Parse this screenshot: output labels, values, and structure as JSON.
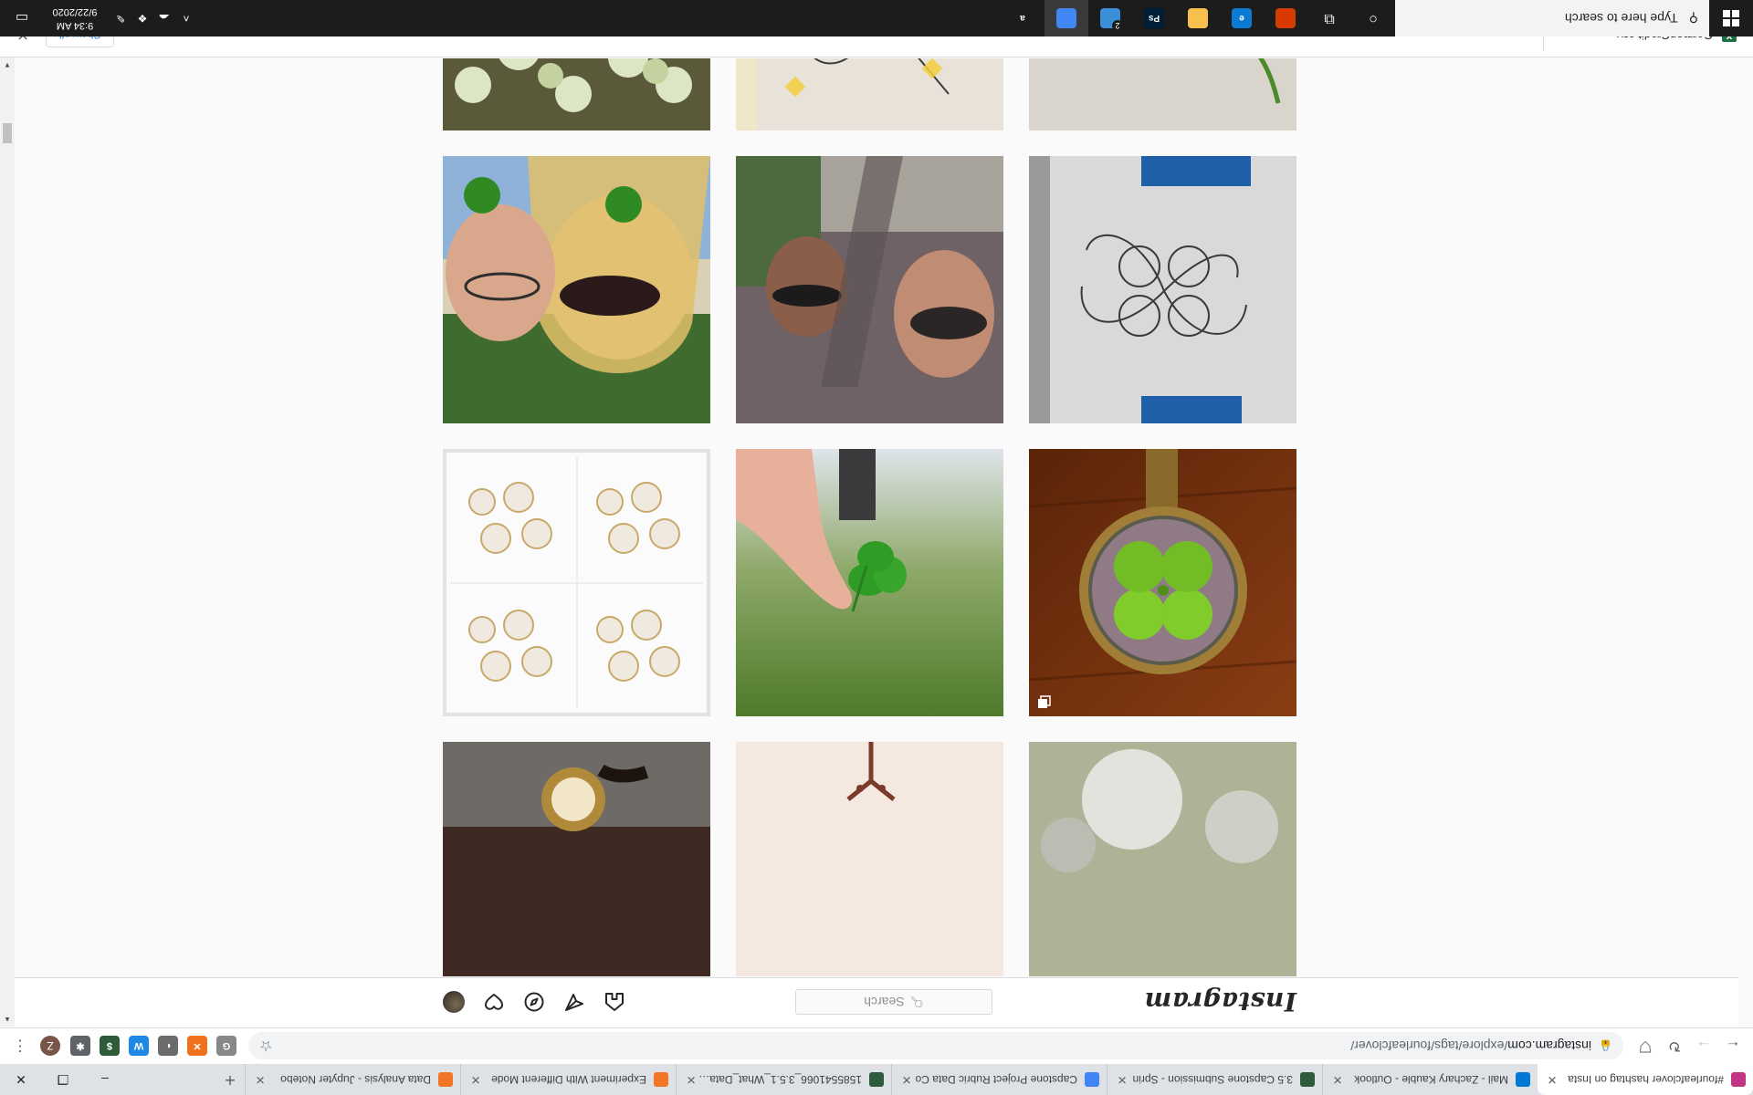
{
  "browser": {
    "tabs": [
      {
        "title": "#fourleafclover hashtag on Insta",
        "favicon": "instagram-icon",
        "color": "#c13584",
        "active": true
      },
      {
        "title": "Mail - Zachary Kauble - Outlook",
        "favicon": "outlook-icon",
        "color": "#0078d4",
        "active": false
      },
      {
        "title": "3.5 Capstone Submission - Sprin",
        "favicon": "course-icon",
        "color": "#2e5c3a",
        "active": false
      },
      {
        "title": "Capstone Project Rubric Data Co",
        "favicon": "docs-icon",
        "color": "#4285f4",
        "active": false
      },
      {
        "title": "1585541066_3.5.1_What_Data_to",
        "favicon": "course-icon",
        "color": "#2e5c3a",
        "active": false
      },
      {
        "title": "Experiment With Different Mode",
        "favicon": "jupyter-icon",
        "color": "#f37626",
        "active": false
      },
      {
        "title": "Data Analysis - Jupyter Notebo",
        "favicon": "jupyter-icon",
        "color": "#f37626",
        "active": false
      }
    ],
    "url_host": "instagram.com",
    "url_path": "/explore/tags/fourleafclover/",
    "profile_initial": "Z",
    "extensions": [
      {
        "name": "grammarly-ext-icon",
        "color": "#888888",
        "glyph": "G"
      },
      {
        "name": "orange-ext-icon",
        "color": "#f2711c",
        "glyph": "✕"
      },
      {
        "name": "dark-circle-ext-icon",
        "color": "#6b6b6b",
        "glyph": "◐"
      },
      {
        "name": "blue-ext-icon",
        "color": "#1e88e5",
        "glyph": "W"
      },
      {
        "name": "course-ext-icon",
        "color": "#2e5c3a",
        "glyph": "$"
      },
      {
        "name": "puzzle-ext-icon",
        "color": "#5f6368",
        "glyph": "✱"
      }
    ]
  },
  "instagram": {
    "logo_text": "Instagram",
    "search_placeholder": "Search",
    "nav_icons": [
      "home-icon",
      "messenger-icon",
      "explore-icon",
      "activity-heart-icon",
      "profile-avatar"
    ]
  },
  "posts": [
    {
      "name": "post-clover-shamrocks-bottom-partial",
      "row": 0,
      "col": 0,
      "desc": "shamrocks on dirt"
    },
    {
      "name": "post-drawing-partial",
      "row": 0,
      "col": 1,
      "desc": "line drawing"
    },
    {
      "name": "post-pendant-partial",
      "row": 0,
      "col": 2,
      "desc": "pendant with clover"
    },
    {
      "name": "post-pendant-clover",
      "row": 1,
      "col": 0,
      "multi": true
    },
    {
      "name": "post-hand-holding-clover",
      "row": 1,
      "col": 1
    },
    {
      "name": "post-pearl-charms",
      "row": 1,
      "col": 2
    },
    {
      "name": "post-skull-clover-sketch",
      "row": 2,
      "col": 0
    },
    {
      "name": "post-car-selfie",
      "row": 2,
      "col": 1
    },
    {
      "name": "post-friends-with-clovers",
      "row": 2,
      "col": 2
    },
    {
      "name": "post-four-leaf-clover-stem",
      "row": 3,
      "col": 0
    },
    {
      "name": "post-clover-tattoo-drawing",
      "row": 3,
      "col": 1
    },
    {
      "name": "post-clover-patch",
      "row": 3,
      "col": 2
    }
  ],
  "downloads": {
    "file_name": "GermanCredit.csv",
    "show_all_label": "Show all"
  },
  "taskbar": {
    "search_placeholder": "Type here to search",
    "time": "9:34 AM",
    "date": "9/22/2020",
    "apps": [
      {
        "name": "cortana-icon",
        "glyph": "○"
      },
      {
        "name": "task-view-icon",
        "glyph": "⧉"
      },
      {
        "name": "office-icon",
        "glyph": "",
        "color": "#d83b01"
      },
      {
        "name": "edge-icon",
        "glyph": "e",
        "color": "#0c7bd4"
      },
      {
        "name": "file-explorer-icon",
        "glyph": "",
        "color": "#f8c04a"
      },
      {
        "name": "photoshop-icon",
        "glyph": "Ps",
        "color": "#001e36"
      },
      {
        "name": "onedrive-photos-icon",
        "glyph": "",
        "color": "#3a8fd8"
      },
      {
        "name": "chrome-icon",
        "glyph": "",
        "color": "#4285f4",
        "active": true
      },
      {
        "name": "amazon-icon",
        "glyph": "a",
        "color": "#1c1c1c"
      }
    ],
    "onedrive_badge": "2"
  }
}
